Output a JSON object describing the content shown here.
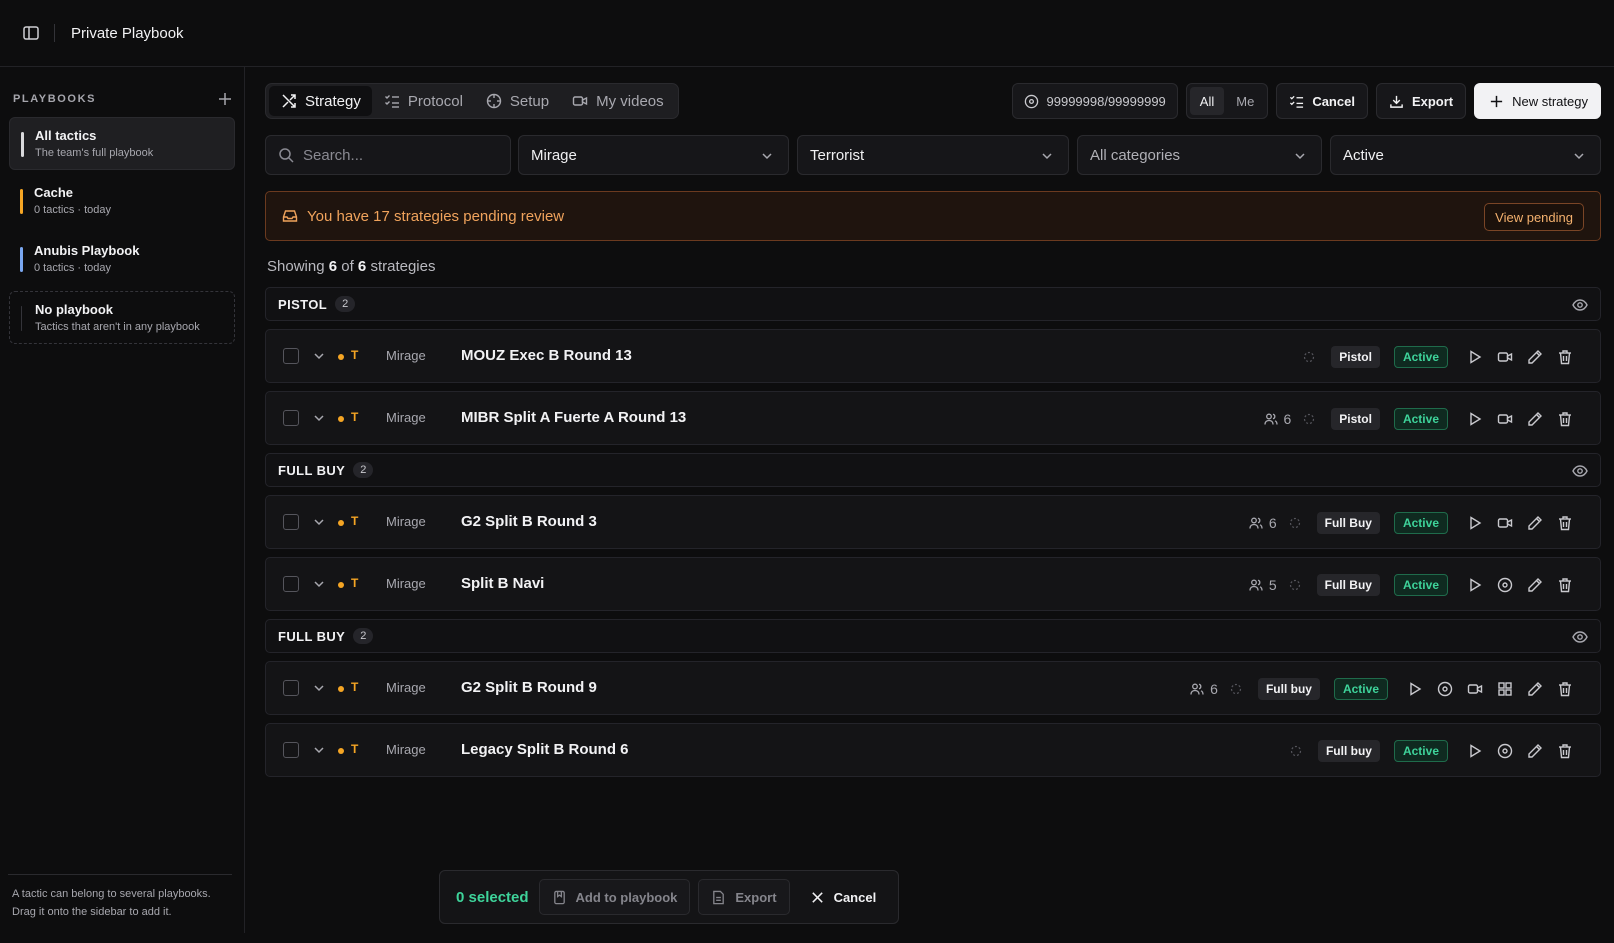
{
  "app": {
    "title": "Private Playbook"
  },
  "sidebar": {
    "section_label": "PLAYBOOKS",
    "items": [
      {
        "name": "All tactics",
        "sub": "The team's full playbook",
        "color": "#d9d9dc"
      },
      {
        "name": "Cache",
        "sub": "0 tactics · today",
        "color": "#f5a524"
      },
      {
        "name": "Anubis Playbook",
        "sub": "0 tactics · today",
        "color": "#7aa7f0"
      },
      {
        "name": "No playbook",
        "sub": "Tactics that aren't in any playbook",
        "color": "#34343a"
      }
    ],
    "footer_line1": "A tactic can belong to several playbooks.",
    "footer_line2": "Drag it onto the sidebar to add it."
  },
  "tabs": [
    {
      "label": "Strategy",
      "icon": "strategy-icon"
    },
    {
      "label": "Protocol",
      "icon": "list-check-icon"
    },
    {
      "label": "Setup",
      "icon": "crosshair-icon"
    },
    {
      "label": "My videos",
      "icon": "video-icon"
    }
  ],
  "toolbar": {
    "counter": "99999998/99999999",
    "scope_all": "All",
    "scope_me": "Me",
    "cancel_label": "Cancel",
    "export_label": "Export",
    "new_label": "New strategy"
  },
  "filters": {
    "search_placeholder": "Search...",
    "map": "Mirage",
    "side": "Terrorist",
    "category": "All categories",
    "status": "Active"
  },
  "banner": {
    "text": "You have 17 strategies pending review",
    "button": "View pending"
  },
  "showing": {
    "prefix": "Showing",
    "shown": "6",
    "of": "of",
    "total": "6",
    "suffix": "strategies"
  },
  "groups": [
    {
      "name": "PISTOL",
      "count": "2",
      "rows": [
        {
          "side": "T",
          "map": "Mirage",
          "name": "MOUZ Exec B Round 13",
          "players": "",
          "category": "Pistol",
          "status": "Active",
          "actions": [
            "play-icon",
            "video-icon",
            "edit-icon",
            "trash-icon"
          ]
        },
        {
          "side": "T",
          "map": "Mirage",
          "name": "MIBR Split A Fuerte A Round 13",
          "players": "6",
          "category": "Pistol",
          "status": "Active",
          "actions": [
            "play-icon",
            "video-icon",
            "edit-icon",
            "trash-icon"
          ]
        }
      ]
    },
    {
      "name": "FULL BUY",
      "count": "2",
      "rows": [
        {
          "side": "T",
          "map": "Mirage",
          "name": "G2 Split B Round 3",
          "players": "6",
          "category": "Full Buy",
          "status": "Active",
          "actions": [
            "play-icon",
            "video-icon",
            "edit-icon",
            "trash-icon"
          ]
        },
        {
          "side": "T",
          "map": "Mirage",
          "name": "Split B Navi",
          "players": "5",
          "category": "Full Buy",
          "status": "Active",
          "actions": [
            "play-icon",
            "target-icon",
            "edit-icon",
            "trash-icon"
          ]
        }
      ]
    },
    {
      "name": "FULL BUY",
      "count": "2",
      "rows": [
        {
          "side": "T",
          "map": "Mirage",
          "name": "G2 Split B Round 9",
          "players": "6",
          "category": "Full buy",
          "status": "Active",
          "actions": [
            "play-icon",
            "target-icon",
            "video-icon",
            "grid-icon",
            "edit-icon",
            "trash-icon"
          ]
        },
        {
          "side": "T",
          "map": "Mirage",
          "name": "Legacy Split B Round 6",
          "players": "",
          "category": "Full buy",
          "status": "Active",
          "actions": [
            "play-icon",
            "target-icon",
            "edit-icon",
            "trash-icon"
          ]
        }
      ]
    }
  ],
  "bulk": {
    "selected": "0 selected",
    "add_label": "Add to playbook",
    "export_label": "Export",
    "cancel_label": "Cancel"
  }
}
